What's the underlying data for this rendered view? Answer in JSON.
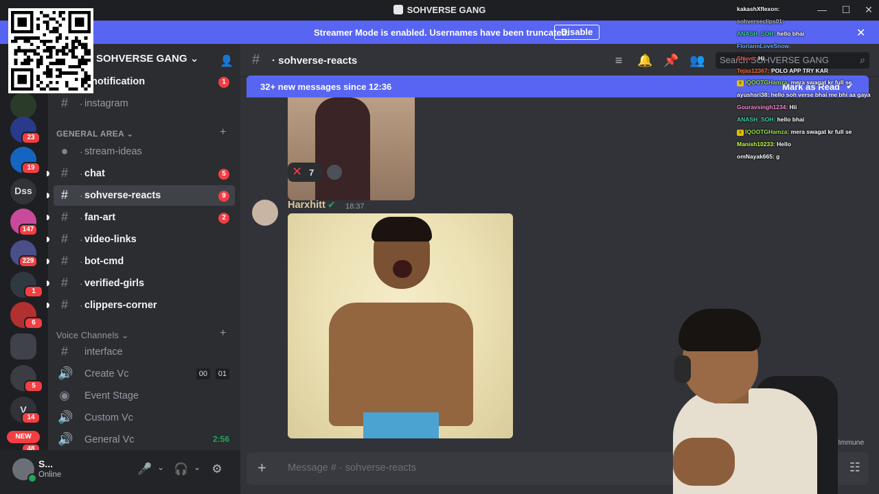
{
  "window": {
    "title": "SOHVERSE GANG",
    "minimize": "—",
    "maximize": "☐",
    "close": "✕"
  },
  "banner": {
    "message": "Streamer Mode is enabled. Usernames have been truncated.",
    "button": "Disable",
    "close": "✕"
  },
  "rail": {
    "badges": [
      "23",
      "19",
      "147",
      "229",
      "1",
      "6",
      "5",
      "14",
      "48"
    ],
    "dss_label": "Dss",
    "v_label": "V",
    "new_label": "NEW"
  },
  "server": {
    "name": "SOHVERSE GANG",
    "chevron": "⌄"
  },
  "channels": {
    "top": [
      {
        "name": "notification",
        "badge": "1"
      },
      {
        "name": "instagram"
      }
    ],
    "general_area": {
      "label": "GENERAL AREA",
      "items": [
        {
          "name": "stream-ideas"
        },
        {
          "name": "chat",
          "badge": "5"
        },
        {
          "name": "sohverse-reacts",
          "badge": "9"
        },
        {
          "name": "fan-art",
          "badge": "2"
        },
        {
          "name": "video-links"
        },
        {
          "name": "bot-cmd"
        },
        {
          "name": "verified-girls"
        },
        {
          "name": "clippers-corner"
        }
      ]
    },
    "voice": {
      "label": "Voice Channels",
      "items": [
        {
          "name": "interface"
        },
        {
          "name": "Create Vc",
          "count_a": "00",
          "count_b": "01"
        },
        {
          "name": "Event Stage"
        },
        {
          "name": "Custom Vc"
        },
        {
          "name": "General Vc",
          "time": "2:56"
        }
      ]
    },
    "dot": "·"
  },
  "user": {
    "name": "S...",
    "status": "Online"
  },
  "chat": {
    "channel": "sohverse-reacts",
    "search_placeholder": "Search SOHVERSE GANG",
    "new_messages": "32+ new messages since 12:36",
    "mark_read": "Mark as Read",
    "reaction_count": "7",
    "message": {
      "author": "Harxhitt",
      "time": "18:37"
    },
    "composer_placeholder": "Message # · sohverse-reacts"
  },
  "overlay": {
    "lines": [
      {
        "user": "kakashXflexon",
        "text": "",
        "color": "#ffffff"
      },
      {
        "user": "sohverseclips01",
        "text": "",
        "color": "#b5bac1"
      },
      {
        "user": "ANASH_SOH",
        "text": "hello bhai",
        "color": "#3fd0a0"
      },
      {
        "user": "FloriannLoveSnow",
        "text": "",
        "color": "#6ab0ff"
      },
      {
        "user": "Shuvo",
        "text": "Hi",
        "color": "#ff5a5a"
      },
      {
        "user": "Tejas12367",
        "text": "POLO APP TRY KAR",
        "color": "#ff6a3d"
      },
      {
        "user": "IQOOTGHamza",
        "text": "mera swagat kr full se",
        "color": "#9be34a",
        "sub": true
      },
      {
        "user": "ayushsri38",
        "text": "hello soh verse bhai me bhi aa gaya",
        "color": "#ffffff"
      },
      {
        "user": "Gouravsingh1234",
        "text": "Hii",
        "color": "#ff8ad0"
      },
      {
        "user": "ANASH_SOH",
        "text": "hello bhai",
        "color": "#3fd0a0"
      },
      {
        "user": "IQOOTGHamza",
        "text": "mera swagat kr full se",
        "color": "#9be34a",
        "sub": true
      },
      {
        "user": "Manish10233",
        "text": "Hello",
        "color": "#c6ff4a"
      },
      {
        "user": "omNayak665",
        "text": "g",
        "color": "#ffffff"
      }
    ]
  },
  "partial_text": "ode Immune"
}
